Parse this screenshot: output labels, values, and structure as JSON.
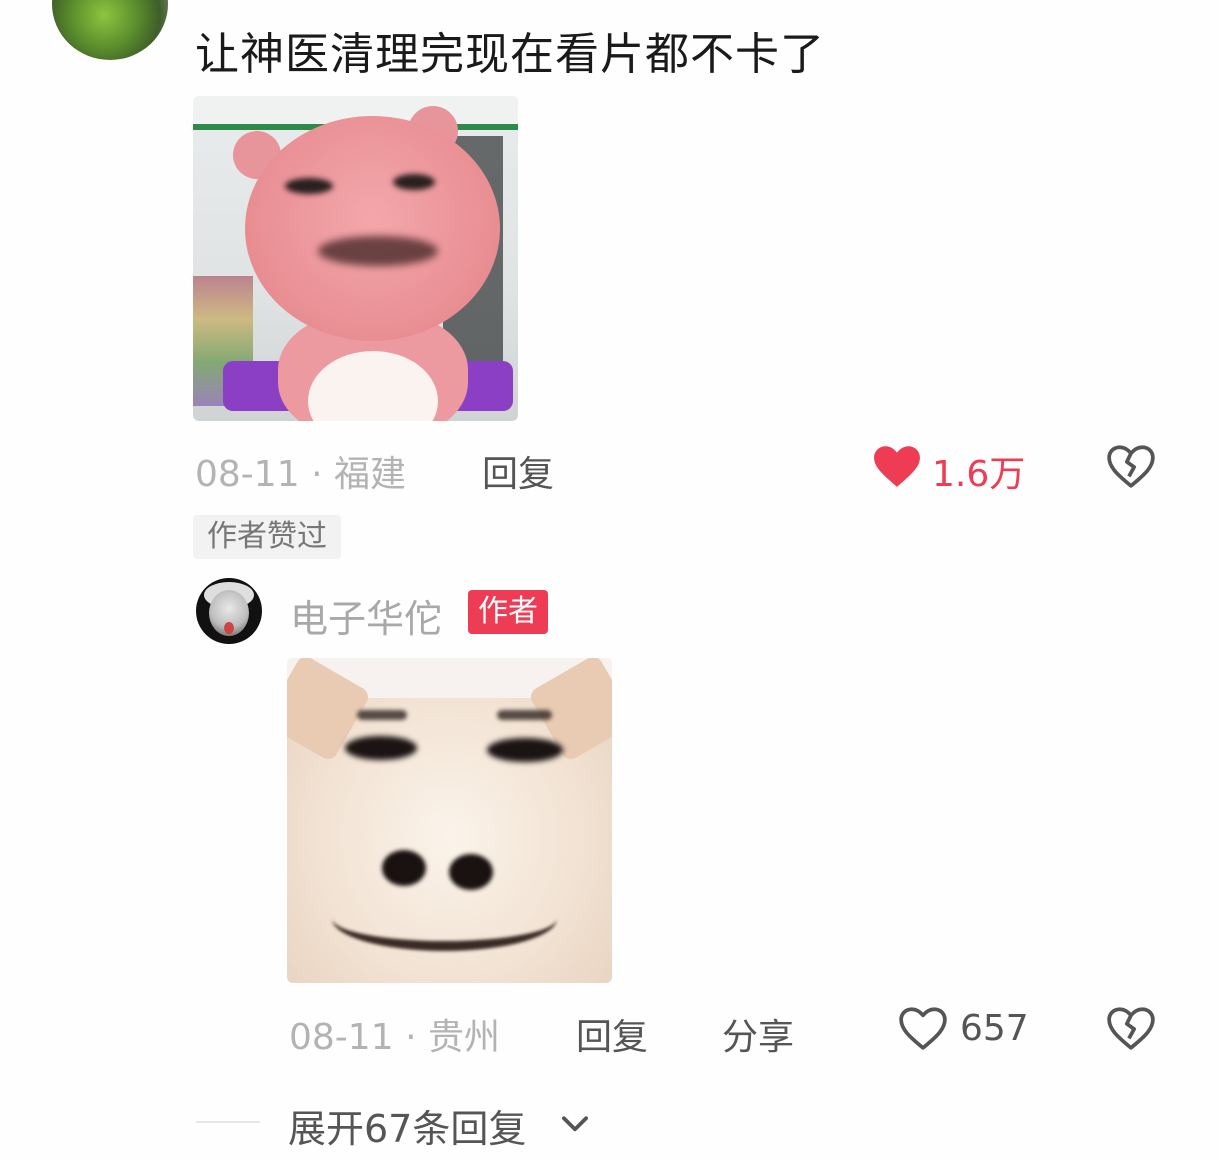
{
  "comment": {
    "text": "让神医清理完现在看片都不卡了",
    "date": "08-11",
    "location": "福建",
    "reply_label": "回复",
    "like_count": "1.6万",
    "liked": true,
    "author_liked_tag": "作者赞过"
  },
  "reply": {
    "username": "电子华佗",
    "author_badge": "作者",
    "date": "08-11",
    "location": "贵州",
    "reply_label": "回复",
    "share_label": "分享",
    "like_count": "657",
    "liked": false
  },
  "expand": {
    "label": "展开67条回复"
  },
  "colors": {
    "accent_red": "#ee3c54",
    "meta_gray": "#b3b3b3",
    "text_dark": "#1a1a1a"
  },
  "icons": [
    "heart-filled-icon",
    "broken-heart-icon",
    "heart-outline-icon",
    "chevron-down-icon"
  ]
}
